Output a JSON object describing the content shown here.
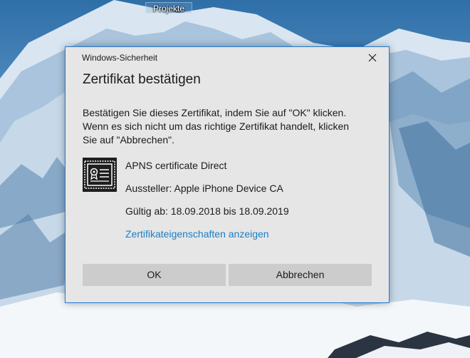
{
  "desktop": {
    "icon_label": "Projekte"
  },
  "dialog": {
    "window_title": "Windows-Sicherheit",
    "heading": "Zertifikat bestätigen",
    "message_lines": [
      "Bestätigen Sie dieses Zertifikat, indem Sie auf \"OK\" klicken.",
      "Wenn es sich nicht um das richtige Zertifikat handelt, klicken",
      "Sie auf \"Abbrechen\"."
    ],
    "certificate": {
      "icon": "certificate-icon",
      "name": "APNS certificate Direct",
      "issuer": "Aussteller: Apple iPhone Device CA",
      "validity": "Gültig ab: 18.09.2018 bis 18.09.2019",
      "properties_link": "Zertifikateigenschaften anzeigen"
    },
    "buttons": {
      "ok": "OK",
      "cancel": "Abbrechen"
    },
    "close_icon": "close-icon"
  },
  "colors": {
    "dialog_background": "#e6e6e6",
    "dialog_border": "#1f7ad1",
    "link": "#1a7fc4",
    "button": "#cccccc"
  }
}
